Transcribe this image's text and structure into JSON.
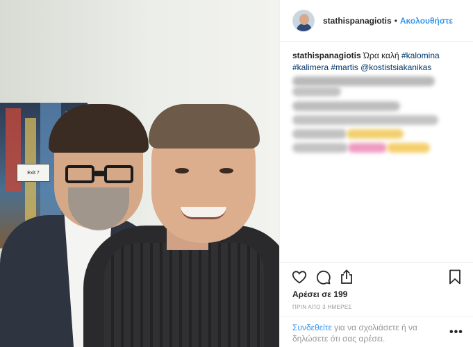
{
  "post": {
    "username": "stathispanagiotis",
    "separator": "•",
    "follow_label": "Ακολουθήστε",
    "caption_text": "Ώρα καλή",
    "caption_tags": [
      "#kalomina",
      "#kalimera",
      "#martis",
      "@kostistsiakanikas"
    ],
    "likes_label": "Αρέσει σε 199",
    "time_label": "ΠΡΙΝ ΑΠΟ 3 ΗΜΕΡΕΣ"
  },
  "photo": {
    "poster_sign": "Exit 7"
  },
  "footer": {
    "login_link": "Συνδεθείτε",
    "login_text": " για να σχολιάσετε ή να δηλώσετε ότι σας αρέσει.",
    "more_label": "•••"
  },
  "icons": {
    "like": "heart-icon",
    "comment": "comment-icon",
    "share": "share-icon",
    "save": "bookmark-icon"
  },
  "colors": {
    "accent": "#3897f0",
    "tag": "#003569",
    "muted": "#999999",
    "text": "#262626"
  }
}
